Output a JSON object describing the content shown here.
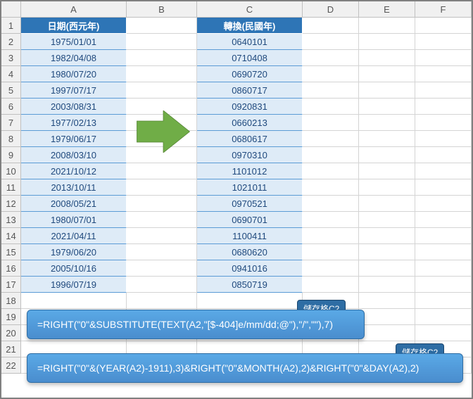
{
  "columns": [
    "A",
    "B",
    "C",
    "D",
    "E",
    "F"
  ],
  "row_count": 22,
  "headers": {
    "A": "日期(西元年)",
    "C": "轉換(民國年)"
  },
  "rows": [
    {
      "a": "1975/01/01",
      "c": "0640101"
    },
    {
      "a": "1982/04/08",
      "c": "0710408"
    },
    {
      "a": "1980/07/20",
      "c": "0690720"
    },
    {
      "a": "1997/07/17",
      "c": "0860717"
    },
    {
      "a": "2003/08/31",
      "c": "0920831"
    },
    {
      "a": "1977/02/13",
      "c": "0660213"
    },
    {
      "a": "1979/06/17",
      "c": "0680617"
    },
    {
      "a": "2008/03/10",
      "c": "0970310"
    },
    {
      "a": "2021/10/12",
      "c": "1101012"
    },
    {
      "a": "2013/10/11",
      "c": "1021011"
    },
    {
      "a": "2008/05/21",
      "c": "0970521"
    },
    {
      "a": "1980/07/01",
      "c": "0690701"
    },
    {
      "a": "2021/04/11",
      "c": "1100411"
    },
    {
      "a": "1979/06/20",
      "c": "0680620"
    },
    {
      "a": "2005/10/16",
      "c": "0941016"
    },
    {
      "a": "1996/07/19",
      "c": "0850719"
    }
  ],
  "formula_tag": "儲存格C2",
  "formula1": "=RIGHT(\"0\"&SUBSTITUTE(TEXT(A2,\"[$-404]e/mm/dd;@\"),\"/\",\"\"),7)",
  "formula2": "=RIGHT(\"0\"&(YEAR(A2)-1911),3)&RIGHT(\"0\"&MONTH(A2),2)&RIGHT(\"0\"&DAY(A2),2)",
  "arrow_color": "#70ad47",
  "chart_data": null
}
